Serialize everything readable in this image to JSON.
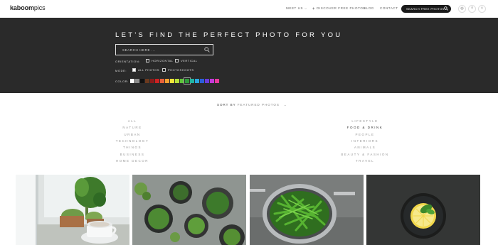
{
  "nav": {
    "logo_bold": "kaboom",
    "logo_light": "pics",
    "meet_us": "MEET US",
    "discover": "DISCOVER FREE PHOTOS",
    "blog": "BLOG",
    "contact": "CONTACT",
    "search_label": "SEARCH FREE PHOTOS...",
    "social": [
      "instagram-icon",
      "facebook-icon",
      "twitter-icon"
    ]
  },
  "hero": {
    "title": "LET'S FIND THE PERFECT PHOTO FOR YOU",
    "search_placeholder": "SEARCH HERE ...",
    "orientation_label": "ORIENTATION:",
    "orientation_options": [
      "HORIZONTAL",
      "VERTICAL"
    ],
    "mode_label": "MODE:",
    "mode_options": [
      "ALL PHOTOS",
      "PHOTOSHOOTS"
    ],
    "mode_selected": "ALL PHOTOS",
    "color_label": "COLOR:",
    "colors": [
      "#ffffff",
      "#8c8c8c",
      "#111111",
      "#6b3a1f",
      "#8b1a1a",
      "#cc2222",
      "#e8623a",
      "#f0a030",
      "#f2e33a",
      "#b5e03a",
      "#5cc23a",
      "#2e9a3a",
      "#22b5a0",
      "#2aa6e0",
      "#2a5fd8",
      "#6a3ad8",
      "#c23ad8",
      "#e83a9a"
    ],
    "color_selected_index": 11
  },
  "sort": {
    "label": "SORT BY",
    "value": "FEATURED PHOTOS"
  },
  "categories": {
    "left": [
      "ALL",
      "NATURE",
      "URBAN",
      "TECHNOLOGY",
      "THINGS",
      "BUSINESS",
      "HOME DECOR"
    ],
    "right": [
      "LIFESTYLE",
      "FOOD & DRINK",
      "PEOPLE",
      "INTERIORS",
      "ANIMALS",
      "BEAUTY & FASHION",
      "TRAVEL"
    ],
    "active": "FOOD & DRINK"
  },
  "photos": [
    {
      "subject": "white cup with plants by window"
    },
    {
      "subject": "herbs in pots top view"
    },
    {
      "subject": "green beans in colander"
    },
    {
      "subject": "lemon slice in dark glass"
    }
  ]
}
